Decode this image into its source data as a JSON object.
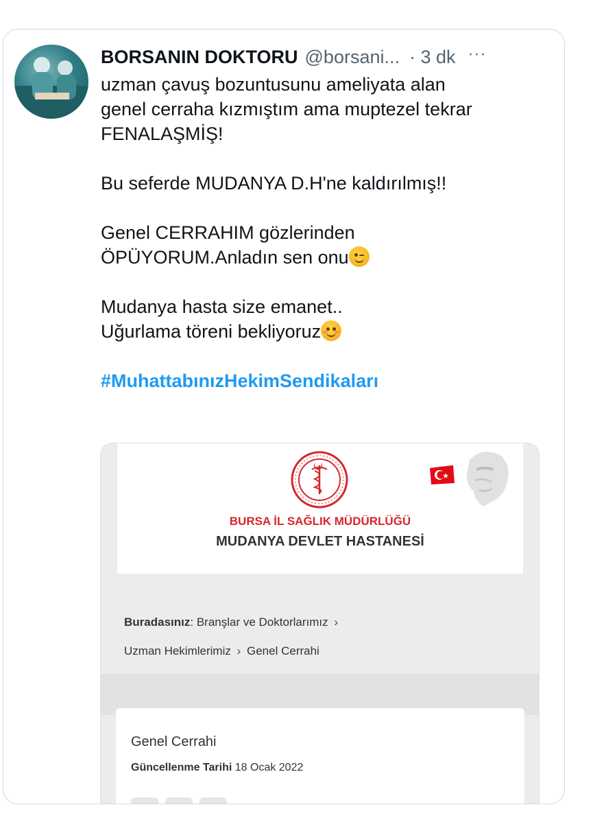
{
  "tweet": {
    "author_name": "BORSANIN DOKTORU",
    "author_handle": "@borsani...",
    "time": "· 3 dk",
    "more": "···",
    "line1": "uzman çavuş bozuntusunu ameliyata alan",
    "line2": "genel cerraha kızmıştım ama  muptezel tekrar",
    "line3": "FENALAŞMİŞ!",
    "line4": "Bu seferde MUDANYA D.H'ne kaldırılmış!!",
    "line5": "Genel CERRAHIM gözlerinden",
    "line6": "ÖPÜYORUM.Anladın sen onu",
    "line7": "Mudanya hasta size emanet..",
    "line8": "Uğurlama töreni bekliyoruz",
    "hashtag": "#MuhattabınızHekimSendikaları",
    "emoji_1": "winking-face-icon",
    "emoji_2": "smiling-face-icon"
  },
  "embed": {
    "institution": "BURSA İL SAĞLIK MÜDÜRLÜĞÜ",
    "hospital": "MUDANYA DEVLET HASTANESİ",
    "breadcrumb_label": "Buradasınız",
    "breadcrumb_colon": ":",
    "crumb1": "Branşlar ve Doktorlarımız",
    "crumb2": "Uzman Hekimlerimiz",
    "crumb3": "Genel Cerrahi",
    "crumb_sep": "›",
    "page_heading": "Genel Cerrahi",
    "updated_label": "Güncellenme Tarihi",
    "updated_date": "18 Ocak 2022"
  },
  "colors": {
    "hashtag": "#1d9bf0",
    "institution": "#d6262c",
    "handle": "#536471"
  }
}
